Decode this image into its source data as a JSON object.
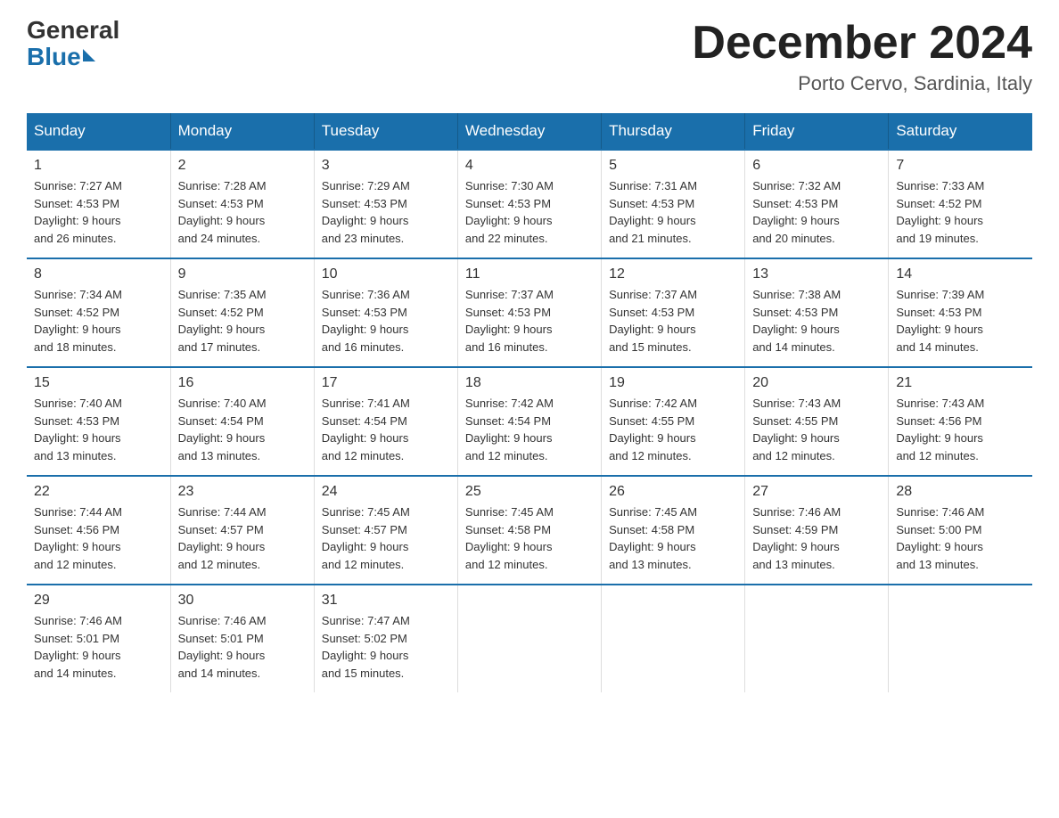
{
  "header": {
    "logo_general": "General",
    "logo_blue": "Blue",
    "month_title": "December 2024",
    "location": "Porto Cervo, Sardinia, Italy"
  },
  "days_of_week": [
    "Sunday",
    "Monday",
    "Tuesday",
    "Wednesday",
    "Thursday",
    "Friday",
    "Saturday"
  ],
  "weeks": [
    [
      {
        "day": "1",
        "sunrise": "7:27 AM",
        "sunset": "4:53 PM",
        "daylight": "9 hours and 26 minutes."
      },
      {
        "day": "2",
        "sunrise": "7:28 AM",
        "sunset": "4:53 PM",
        "daylight": "9 hours and 24 minutes."
      },
      {
        "day": "3",
        "sunrise": "7:29 AM",
        "sunset": "4:53 PM",
        "daylight": "9 hours and 23 minutes."
      },
      {
        "day": "4",
        "sunrise": "7:30 AM",
        "sunset": "4:53 PM",
        "daylight": "9 hours and 22 minutes."
      },
      {
        "day": "5",
        "sunrise": "7:31 AM",
        "sunset": "4:53 PM",
        "daylight": "9 hours and 21 minutes."
      },
      {
        "day": "6",
        "sunrise": "7:32 AM",
        "sunset": "4:53 PM",
        "daylight": "9 hours and 20 minutes."
      },
      {
        "day": "7",
        "sunrise": "7:33 AM",
        "sunset": "4:52 PM",
        "daylight": "9 hours and 19 minutes."
      }
    ],
    [
      {
        "day": "8",
        "sunrise": "7:34 AM",
        "sunset": "4:52 PM",
        "daylight": "9 hours and 18 minutes."
      },
      {
        "day": "9",
        "sunrise": "7:35 AM",
        "sunset": "4:52 PM",
        "daylight": "9 hours and 17 minutes."
      },
      {
        "day": "10",
        "sunrise": "7:36 AM",
        "sunset": "4:53 PM",
        "daylight": "9 hours and 16 minutes."
      },
      {
        "day": "11",
        "sunrise": "7:37 AM",
        "sunset": "4:53 PM",
        "daylight": "9 hours and 16 minutes."
      },
      {
        "day": "12",
        "sunrise": "7:37 AM",
        "sunset": "4:53 PM",
        "daylight": "9 hours and 15 minutes."
      },
      {
        "day": "13",
        "sunrise": "7:38 AM",
        "sunset": "4:53 PM",
        "daylight": "9 hours and 14 minutes."
      },
      {
        "day": "14",
        "sunrise": "7:39 AM",
        "sunset": "4:53 PM",
        "daylight": "9 hours and 14 minutes."
      }
    ],
    [
      {
        "day": "15",
        "sunrise": "7:40 AM",
        "sunset": "4:53 PM",
        "daylight": "9 hours and 13 minutes."
      },
      {
        "day": "16",
        "sunrise": "7:40 AM",
        "sunset": "4:54 PM",
        "daylight": "9 hours and 13 minutes."
      },
      {
        "day": "17",
        "sunrise": "7:41 AM",
        "sunset": "4:54 PM",
        "daylight": "9 hours and 12 minutes."
      },
      {
        "day": "18",
        "sunrise": "7:42 AM",
        "sunset": "4:54 PM",
        "daylight": "9 hours and 12 minutes."
      },
      {
        "day": "19",
        "sunrise": "7:42 AM",
        "sunset": "4:55 PM",
        "daylight": "9 hours and 12 minutes."
      },
      {
        "day": "20",
        "sunrise": "7:43 AM",
        "sunset": "4:55 PM",
        "daylight": "9 hours and 12 minutes."
      },
      {
        "day": "21",
        "sunrise": "7:43 AM",
        "sunset": "4:56 PM",
        "daylight": "9 hours and 12 minutes."
      }
    ],
    [
      {
        "day": "22",
        "sunrise": "7:44 AM",
        "sunset": "4:56 PM",
        "daylight": "9 hours and 12 minutes."
      },
      {
        "day": "23",
        "sunrise": "7:44 AM",
        "sunset": "4:57 PM",
        "daylight": "9 hours and 12 minutes."
      },
      {
        "day": "24",
        "sunrise": "7:45 AM",
        "sunset": "4:57 PM",
        "daylight": "9 hours and 12 minutes."
      },
      {
        "day": "25",
        "sunrise": "7:45 AM",
        "sunset": "4:58 PM",
        "daylight": "9 hours and 12 minutes."
      },
      {
        "day": "26",
        "sunrise": "7:45 AM",
        "sunset": "4:58 PM",
        "daylight": "9 hours and 13 minutes."
      },
      {
        "day": "27",
        "sunrise": "7:46 AM",
        "sunset": "4:59 PM",
        "daylight": "9 hours and 13 minutes."
      },
      {
        "day": "28",
        "sunrise": "7:46 AM",
        "sunset": "5:00 PM",
        "daylight": "9 hours and 13 minutes."
      }
    ],
    [
      {
        "day": "29",
        "sunrise": "7:46 AM",
        "sunset": "5:01 PM",
        "daylight": "9 hours and 14 minutes."
      },
      {
        "day": "30",
        "sunrise": "7:46 AM",
        "sunset": "5:01 PM",
        "daylight": "9 hours and 14 minutes."
      },
      {
        "day": "31",
        "sunrise": "7:47 AM",
        "sunset": "5:02 PM",
        "daylight": "9 hours and 15 minutes."
      },
      null,
      null,
      null,
      null
    ]
  ],
  "labels": {
    "sunrise": "Sunrise:",
    "sunset": "Sunset:",
    "daylight": "Daylight:"
  }
}
